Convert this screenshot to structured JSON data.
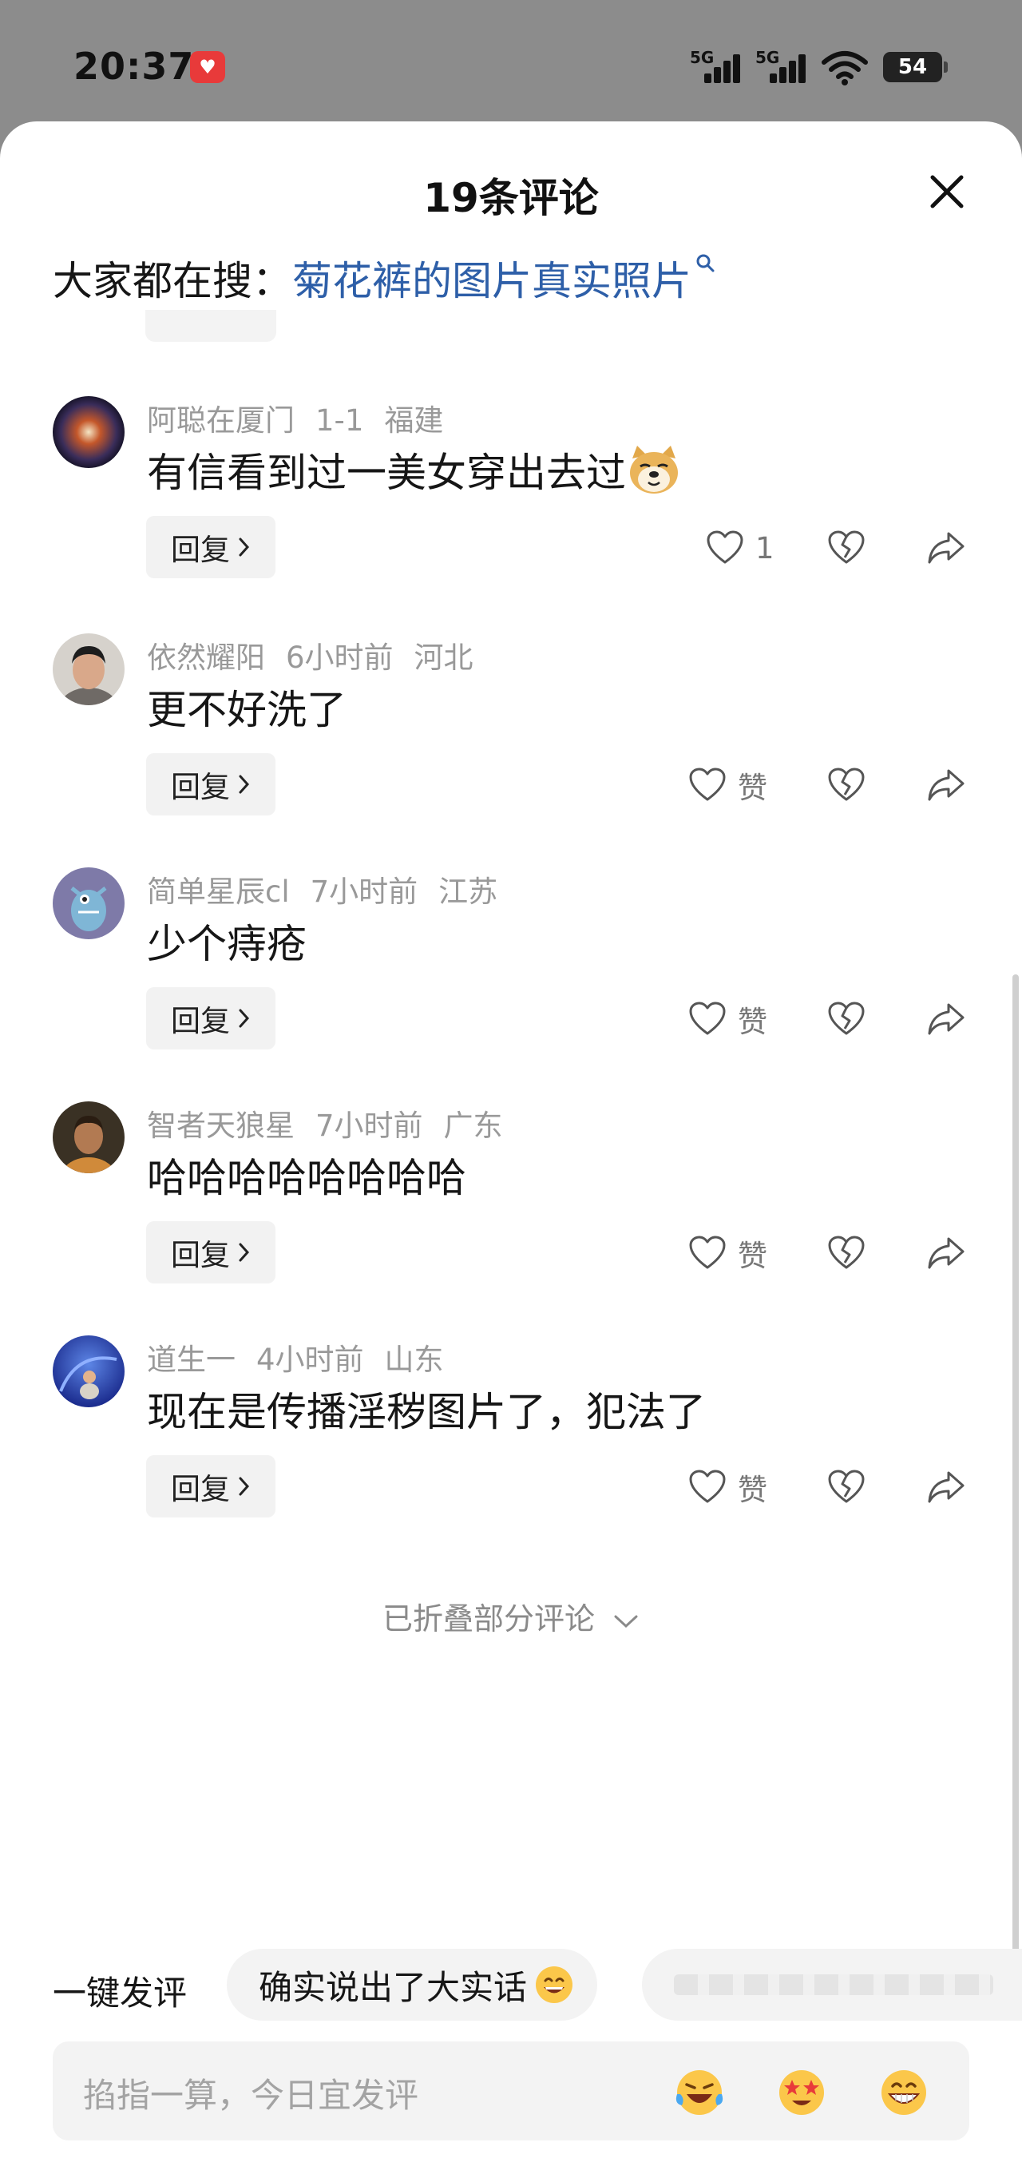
{
  "status_bar": {
    "time": "20:37",
    "signal1_label": "5G",
    "signal2_label": "5G",
    "battery": "54"
  },
  "sheet": {
    "title": "19条评论",
    "search_prefix": "大家都在搜：",
    "search_term": "菊花裤的图片真实照片"
  },
  "comments": [
    {
      "user": "阿聪在厦门",
      "time": "1-1",
      "region": "福建",
      "text": "有信看到过一美女穿出去过",
      "emoji": "doge",
      "likes": "1"
    },
    {
      "user": "依然耀阳",
      "time": "6小时前",
      "region": "河北",
      "text": "更不好洗了",
      "likes": "赞"
    },
    {
      "user": "简单星辰cl",
      "time": "7小时前",
      "region": "江苏",
      "text": "少个痔疮",
      "likes": "赞"
    },
    {
      "user": "智者天狼星",
      "time": "7小时前",
      "region": "广东",
      "text": "哈哈哈哈哈哈哈哈",
      "likes": "赞"
    },
    {
      "user": "道生一",
      "time": "4小时前",
      "region": "山东",
      "text": "现在是传播淫秽图片了，犯法了",
      "likes": "赞"
    }
  ],
  "reply_label": "回复",
  "folded_label": "已折叠部分评论",
  "quick_comment": {
    "label": "一键发评",
    "chip1": "确实说出了大实话"
  },
  "input": {
    "placeholder": "掐指一算，今日宜发评"
  },
  "icons": [
    "heart-icon",
    "heart-broken-icon",
    "share-icon",
    "close-icon",
    "search-icon",
    "chevron-right-icon",
    "chevron-down-icon"
  ],
  "colors": {
    "link": "#2e5fa8",
    "meta": "#999999",
    "chip_bg": "#f3f3f3"
  }
}
